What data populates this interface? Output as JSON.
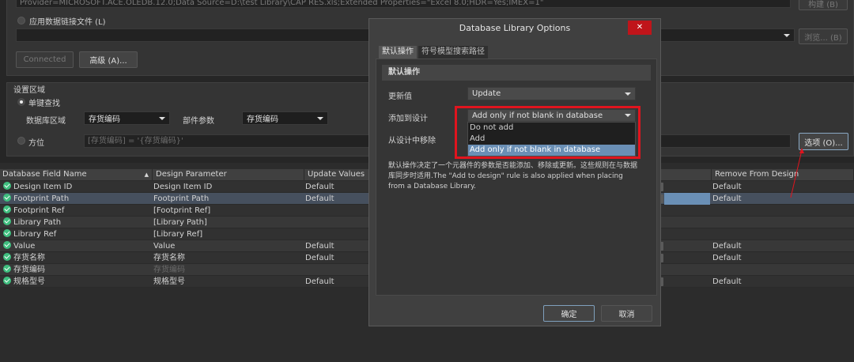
{
  "top": {
    "connection_string": "Provider=MICROSOFT.ACE.OLEDB.12.0;Data Source=D:\\test Library\\CAP RES.xls;Extended Properties=\"Excel 8.0;HDR=Yes;IMEX=1\"",
    "build_button": "构建 (B)",
    "use_link_file_label": "应用数据链接文件 (L)",
    "browse_button": "浏览... (B)",
    "connected_button": "Connected",
    "advanced_button": "高级 (A)..."
  },
  "settings": {
    "group_label": "设置区域",
    "single_key_label": "单键查找",
    "db_field_label": "数据库区域",
    "db_field_value": "存货编码",
    "part_param_label": "部件参数",
    "part_param_value": "存货编码",
    "where_label": "方位",
    "where_value": "[存货编码] = '{存货编码}'",
    "options_button": "选项 (O)..."
  },
  "table": {
    "headers": [
      "Database Field Name",
      "Design Parameter",
      "Update Values",
      "Remove From Design"
    ],
    "rows": [
      {
        "field": "Design Item ID",
        "param": "Design Item ID",
        "update": "Default",
        "remove": "Default"
      },
      {
        "field": "Footprint Path",
        "param": "Footprint Path",
        "update": "Default",
        "remove": "Default"
      },
      {
        "field": "Footprint Ref",
        "param": "[Footprint Ref]",
        "update": "",
        "remove": ""
      },
      {
        "field": "Library Path",
        "param": "[Library Path]",
        "update": "",
        "remove": ""
      },
      {
        "field": "Library Ref",
        "param": "[Library Ref]",
        "update": "",
        "remove": ""
      },
      {
        "field": "Value",
        "param": "Value",
        "update": "Default",
        "remove": "Default"
      },
      {
        "field": "存货名称",
        "param": "存货名称",
        "update": "Default",
        "remove": "Default"
      },
      {
        "field": "存货编码",
        "param": "存货编码",
        "update": "",
        "remove": ""
      },
      {
        "field": "规格型号",
        "param": "规格型号",
        "update": "Default",
        "remove": "Default"
      }
    ]
  },
  "dialog": {
    "title": "Database Library Options",
    "tabs": [
      "默认操作",
      "符号模型搜索路径"
    ],
    "section": "默认操作",
    "update_label": "更新值",
    "update_value": "Update",
    "add_label": "添加到设计",
    "add_value": "Add only if not blank in database",
    "add_options": [
      "Do not add",
      "Add",
      "Add only if not blank in database"
    ],
    "remove_label": "从设计中移除",
    "description": "默认操作决定了一个元器件的参数是否能添加、移除或更新。这些规则在与数据库同步时适用.The \"Add to design\" rule is also applied when placing from a Database Library.",
    "ok": "确定",
    "cancel": "取消"
  },
  "colors": {
    "highlight": "#e0141e",
    "selection": "#6a8fb5",
    "check": "#3fbf7f"
  }
}
